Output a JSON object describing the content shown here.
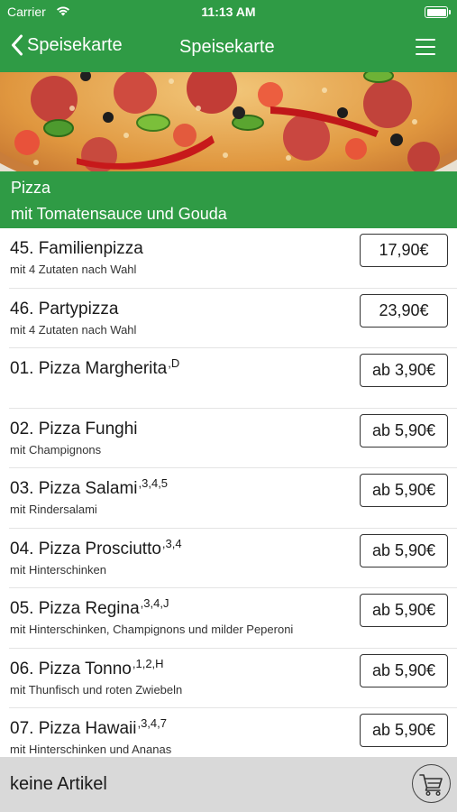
{
  "status_bar": {
    "carrier": "Carrier",
    "time": "11:13 AM",
    "battery_level": 1.0
  },
  "nav": {
    "back_label": "Speisekarte",
    "title": "Speisekarte",
    "back_icon": "chevron-left-icon",
    "menu_icon": "hamburger-menu-icon"
  },
  "category": {
    "name": "Pizza",
    "description": "mit Tomatensauce und Gouda"
  },
  "items": [
    {
      "title": "45. Familienpizza",
      "allergens": "",
      "description": "mit 4 Zutaten nach Wahl",
      "price": "17,90€"
    },
    {
      "title": "46. Partypizza",
      "allergens": "",
      "description": "mit 4 Zutaten nach Wahl",
      "price": "23,90€"
    },
    {
      "title": "01. Pizza Margherita",
      "allergens": ",D",
      "description": "",
      "price": "ab 3,90€"
    },
    {
      "title": "02. Pizza Funghi",
      "allergens": "",
      "description": "mit Champignons",
      "price": "ab 5,90€"
    },
    {
      "title": "03. Pizza Salami",
      "allergens": ",3,4,5",
      "description": "mit Rindersalami",
      "price": "ab 5,90€"
    },
    {
      "title": "04. Pizza Prosciutto",
      "allergens": ",3,4",
      "description": "mit Hinterschinken",
      "price": "ab 5,90€"
    },
    {
      "title": "05. Pizza Regina",
      "allergens": ",3,4,J",
      "description": "mit Hinterschinken, Champignons und milder Peperoni",
      "price": "ab 5,90€"
    },
    {
      "title": "06. Pizza Tonno",
      "allergens": ",1,2,H",
      "description": "mit Thunfisch und roten Zwiebeln",
      "price": "ab 5,90€"
    },
    {
      "title": "07. Pizza Hawaii",
      "allergens": ",3,4,7",
      "description": "mit Hinterschinken und Ananas",
      "price": "ab 5,90€"
    }
  ],
  "cart": {
    "label": "keine Artikel",
    "icon": "shopping-cart-icon"
  },
  "colors": {
    "brand_green": "#2f9b45",
    "cart_bar_bg": "#d9d9d9"
  }
}
